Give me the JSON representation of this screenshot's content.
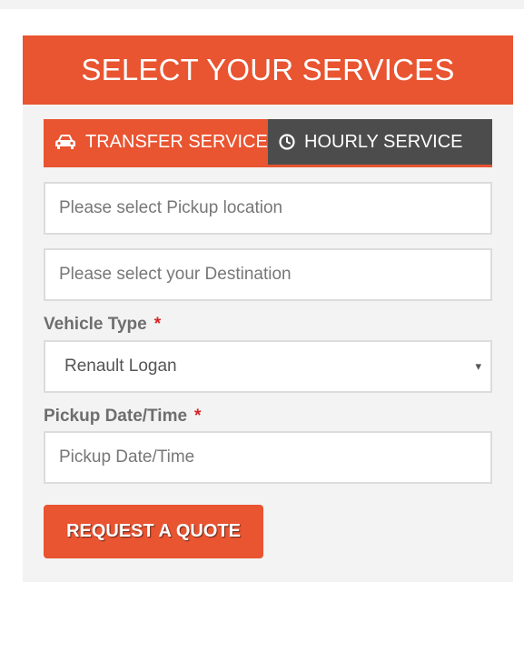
{
  "header": {
    "title": "SELECT YOUR SERVICES"
  },
  "tabs": [
    {
      "label": "TRANSFER SERVICE",
      "icon": "car-icon",
      "active": true
    },
    {
      "label": "HOURLY SERVICE",
      "icon": "clock-icon",
      "active": false
    }
  ],
  "form": {
    "pickup": {
      "placeholder": "Please select Pickup location"
    },
    "destination": {
      "placeholder": "Please select your Destination"
    },
    "vehicle_type": {
      "label": "Vehicle Type",
      "required_mark": "*",
      "value": "Renault Logan",
      "arrow": "▾"
    },
    "pickup_datetime": {
      "label": "Pickup Date/Time",
      "required_mark": "*",
      "placeholder": "Pickup Date/Time"
    },
    "submit_label": "REQUEST A QUOTE"
  },
  "colors": {
    "accent": "#e95431",
    "tab_inactive": "#4c4c4c",
    "panel_bg": "#f3f3f3",
    "required": "#d62323"
  }
}
